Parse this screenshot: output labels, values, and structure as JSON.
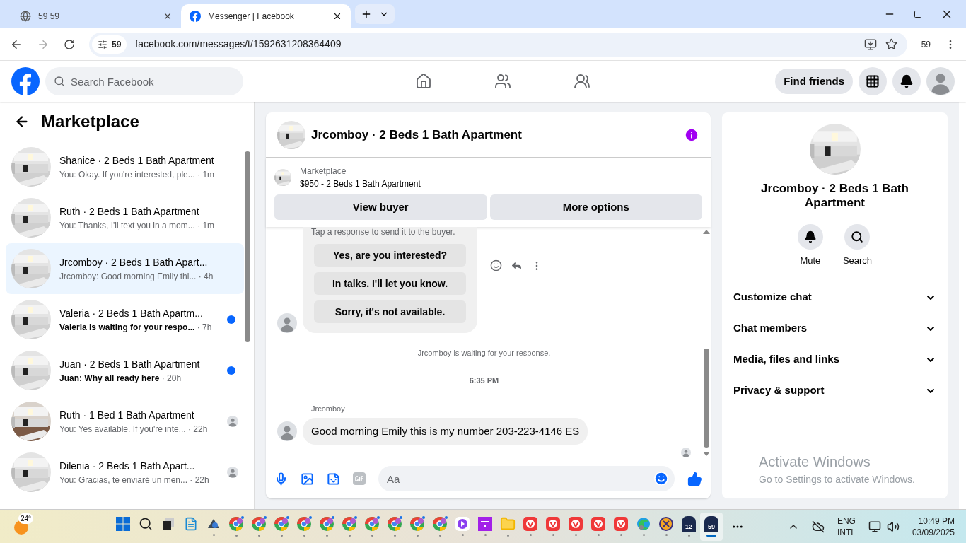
{
  "browser": {
    "tabs": [
      {
        "title": "59 59",
        "selected": false
      },
      {
        "title": "Messenger | Facebook",
        "selected": true
      }
    ],
    "site_badge": "59",
    "address": "facebook.com/messages/t/1592631208364409",
    "profile_count": "59"
  },
  "header": {
    "search_placeholder": "Search Facebook",
    "nav": [
      {
        "kind": "home",
        "selected": false
      },
      {
        "kind": "friends",
        "selected": false
      },
      {
        "kind": "groups",
        "selected": false
      }
    ],
    "find_friends": "Find friends"
  },
  "sidebar": {
    "title": "Marketplace",
    "conversations": [
      {
        "name": "Shanice · 2 Beds 1 Bath Apartment",
        "preview": "You: Okay. If you're interested, ple...",
        "time": " · 1m",
        "selected": false,
        "unread": false,
        "seen": false
      },
      {
        "name": "Ruth · 2 Beds 1 Bath Apartment",
        "preview": "You: Thanks, I'll text you in a mom...",
        "time": " · 1m",
        "selected": false,
        "unread": false,
        "seen": false
      },
      {
        "name": "Jrcomboy · 2 Beds 1 Bath Apart...",
        "preview": "Jrcomboy: Good morning Emily thi...",
        "time": " · 4h",
        "selected": true,
        "unread": false,
        "seen": false
      },
      {
        "name": "Valeria · 2 Beds 1 Bath Apartm...",
        "preview": "Valeria is waiting for your respo...",
        "time": " · 7h",
        "selected": false,
        "unread": true,
        "seen": false
      },
      {
        "name": "Juan · 2 Beds 1 Bath Apartment",
        "preview": "Juan: Why all ready here",
        "time": " · 20h",
        "selected": false,
        "unread": true,
        "seen": false
      },
      {
        "name": "Ruth · 1 Bed 1 Bath Apartment",
        "preview": "You: Yes available. If you're inte...",
        "time": " · 22h",
        "selected": false,
        "unread": false,
        "seen": true
      },
      {
        "name": "Dilenia · 2 Beds 1 Bath Apart...",
        "preview": "You: Gracias, te enviaré un men...",
        "time": " · 22h",
        "selected": false,
        "unread": false,
        "seen": true
      }
    ]
  },
  "chat": {
    "title": "Jrcomboy · 2 Beds 1 Bath Apartment",
    "listing": {
      "label": "Marketplace",
      "price_title": "$950 - 2 Beds 1 Bath Apartment"
    },
    "actions": [
      "View buyer",
      "More options"
    ],
    "quick_replies": {
      "hint": "Tap a response to send it to the buyer.",
      "options": [
        "Yes, are you interested?",
        "In talks. I'll let you know.",
        "Sorry, it's not available."
      ]
    },
    "status": "Jrcomboy is waiting for your response.",
    "timestamp": "6:35 PM",
    "sender": "Jrcomboy",
    "message": "Good morning Emily this is my number 203-223-4146 ES",
    "composer_placeholder": "Aa"
  },
  "details": {
    "title": "Jrcomboy · 2 Beds 1 Bath Apartment",
    "actions": [
      {
        "kind": "mute",
        "label": "Mute"
      },
      {
        "kind": "search",
        "label": "Search"
      }
    ],
    "sections": [
      {
        "label": "Customize chat",
        "expanded": false
      },
      {
        "label": "Chat members",
        "expanded": false
      },
      {
        "label": "Media, files and links",
        "expanded": false
      },
      {
        "label": "Privacy & support",
        "expanded": false
      }
    ]
  },
  "activation_notice": {
    "title": "Activate Windows",
    "text": "Go to Settings to activate Windows."
  },
  "taskbar": {
    "weather": "24°",
    "apps": [
      {
        "kind": "start",
        "selected": false
      },
      {
        "kind": "search",
        "selected": false
      },
      {
        "kind": "taskview",
        "selected": false
      },
      {
        "kind": "notepad",
        "selected": false
      },
      {
        "kind": "app",
        "selected": false
      },
      {
        "kind": "chrome",
        "selected": false
      },
      {
        "kind": "chrome",
        "selected": false
      },
      {
        "kind": "chrome",
        "selected": false
      },
      {
        "kind": "chrome",
        "selected": false
      },
      {
        "kind": "chrome",
        "selected": false
      },
      {
        "kind": "chrome",
        "selected": false
      },
      {
        "kind": "chrome",
        "selected": false
      },
      {
        "kind": "chrome",
        "selected": false
      },
      {
        "kind": "chrome",
        "selected": false
      },
      {
        "kind": "chrome",
        "selected": false
      },
      {
        "kind": "purple",
        "selected": false
      },
      {
        "kind": "square",
        "selected": false
      },
      {
        "kind": "folder",
        "selected": false
      },
      {
        "kind": "vivaldi",
        "selected": false
      },
      {
        "kind": "vivaldi",
        "selected": false
      },
      {
        "kind": "vivaldi",
        "selected": false
      },
      {
        "kind": "vivaldi",
        "selected": false
      },
      {
        "kind": "vivaldi",
        "selected": false
      },
      {
        "kind": "edge",
        "selected": false
      },
      {
        "kind": "ix",
        "selected": false
      },
      {
        "kind": "calendar",
        "badge": "12",
        "selected": false
      },
      {
        "kind": "calendar",
        "badge": "59",
        "selected": true
      }
    ],
    "language": [
      "ENG",
      "INTL"
    ],
    "time": "10:49 PM",
    "date": "03/09/2025"
  }
}
